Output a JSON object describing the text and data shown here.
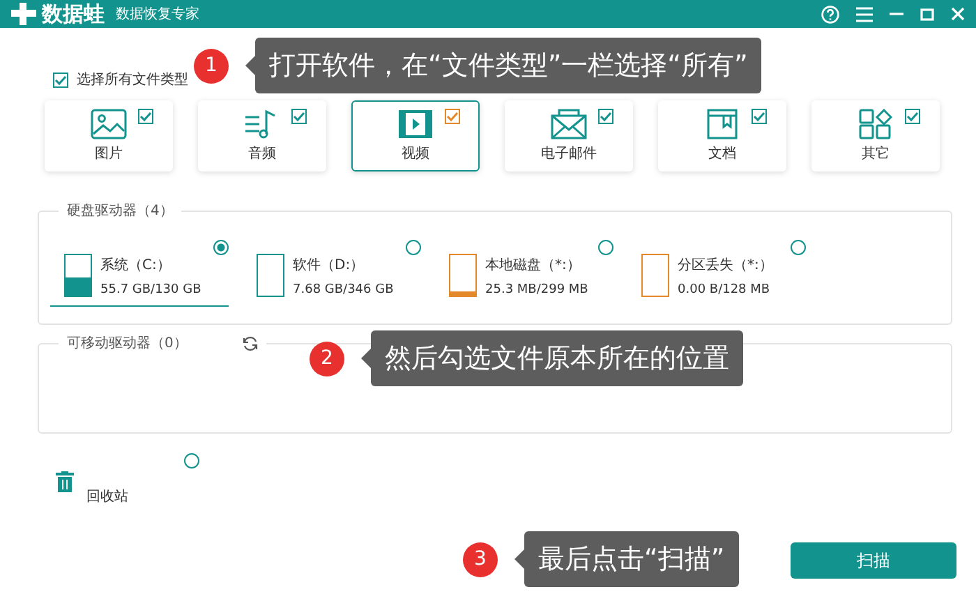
{
  "title_bar": {
    "app_name": "数据蛙",
    "subtitle": "数据恢复专家"
  },
  "select_all": {
    "label": "选择所有文件类型",
    "checked": true
  },
  "file_types": [
    {
      "kind": "image",
      "label": "图片",
      "checked": true,
      "selected": false
    },
    {
      "kind": "audio",
      "label": "音频",
      "checked": true,
      "selected": false
    },
    {
      "kind": "video",
      "label": "视频",
      "checked": true,
      "selected": true
    },
    {
      "kind": "email",
      "label": "电子邮件",
      "checked": true,
      "selected": false
    },
    {
      "kind": "document",
      "label": "文档",
      "checked": true,
      "selected": false
    },
    {
      "kind": "other",
      "label": "其它",
      "checked": true,
      "selected": false
    }
  ],
  "hard_drives": {
    "title": "硬盘驱动器（4）",
    "items": [
      {
        "name": "系统（C:）",
        "size": "55.7 GB/130 GB",
        "selected": true,
        "level": 0.45,
        "color": "#13938d"
      },
      {
        "name": "软件（D:）",
        "size": "7.68 GB/346 GB",
        "selected": false,
        "color": "#13938d"
      },
      {
        "name": "本地磁盘（*:）",
        "size": "25.3 MB/299 MB",
        "selected": false,
        "level": 0.12,
        "color": "#e3892a"
      },
      {
        "name": "分区丢失（*:）",
        "size": "0.00 B/128 MB",
        "selected": false,
        "color": "#e3892a"
      }
    ]
  },
  "removable_drives": {
    "title": "可移动驱动器（0）"
  },
  "recycle_bin": {
    "label": "回收站",
    "selected": false
  },
  "scan_button": "扫描",
  "callouts": [
    {
      "number": "1",
      "text": "打开软件，在“文件类型”一栏选择“所有”"
    },
    {
      "number": "2",
      "text": "然后勾选文件原本所在的位置"
    },
    {
      "number": "3",
      "text": "最后点击“扫描”"
    }
  ]
}
